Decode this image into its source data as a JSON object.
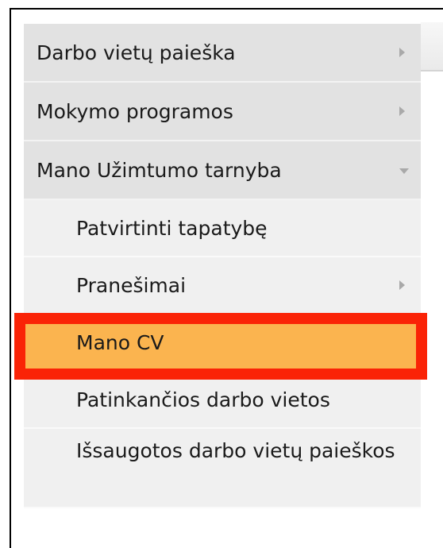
{
  "menu": {
    "items": [
      {
        "label": "Darbo vietų paieška",
        "icon": "chevron-right-icon"
      },
      {
        "label": "Mokymo programos",
        "icon": "chevron-right-icon"
      },
      {
        "label": "Mano Užimtumo tarnyba",
        "icon": "chevron-down-icon",
        "expanded": true
      }
    ],
    "submenu": [
      {
        "label": "Patvirtinti tapatybę"
      },
      {
        "label": "Pranešimai",
        "icon": "chevron-right-icon"
      },
      {
        "label": "Mano CV",
        "selected": true
      },
      {
        "label": "Patinkančios darbo vietos"
      },
      {
        "label": "Išsaugotos darbo vietų paieškos"
      }
    ]
  },
  "colors": {
    "top_item_bg": "#e2e2e2",
    "sub_item_bg": "#f0f0f0",
    "active_bg": "#fbb44f",
    "highlight_border": "#fa2306"
  }
}
